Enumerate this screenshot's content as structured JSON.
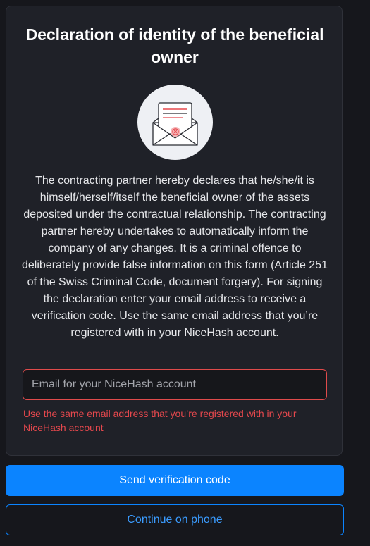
{
  "dialog": {
    "title": "Declaration of identity of the beneficial owner",
    "illustration_icon": "open-envelope-with-letter-icon",
    "body": "The contracting partner hereby declares that he/she/it is himself/herself/itself the beneficial owner of the assets deposited under the contractual relationship. The contracting partner hereby undertakes to automatically inform the company of any changes. It is a criminal offence to deliberately provide false information on this form (Article 251 of the Swiss Criminal Code, document forgery). For signing the declaration enter your email address to receive a verification code. Use the same email address that you’re registered with in your NiceHash account.",
    "email_field": {
      "placeholder": "Email for your NiceHash account",
      "value": ""
    },
    "error_message": "Use the same email address that you’re registered with in your NiceHash account"
  },
  "actions": {
    "send_code_label": "Send verification code",
    "continue_phone_label": "Continue on phone"
  },
  "colors": {
    "background": "#16171c",
    "card": "#1f2128",
    "primary": "#0b84ff",
    "error": "#e5484d"
  }
}
